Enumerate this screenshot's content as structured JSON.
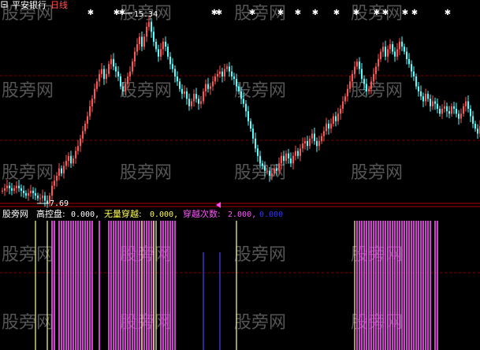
{
  "window": {
    "title_icon": "minus-box-icon",
    "stock_name": "平安银行",
    "period": "日线"
  },
  "colors": {
    "background": "#000000",
    "up": "#ff5555",
    "down": "#54ffff",
    "marker": "#ffffff",
    "divider": "#b00000",
    "grid": "#7a0000",
    "label_default": "#ffffff",
    "label_gaokong": "#ffffff",
    "label_wuliang": "#ffff55",
    "label_chuanyue": "#ff55ff",
    "label_extra": "#3333ff",
    "bar_magenta": "#ff55ff",
    "bar_yellow": "#ffff99",
    "bar_blue": "#4444ff",
    "arrow_magenta": "#ff44ff",
    "watermark": "#555555"
  },
  "watermark": "股旁网",
  "main_panel": {
    "high_label": "15.34",
    "low_label": "7.69"
  },
  "indicator": {
    "name": "股旁网",
    "items": [
      {
        "label": "高控盘:",
        "value": "0.000,"
      },
      {
        "label": "无量穿越:",
        "value": "0.000,"
      },
      {
        "label": "穿越次数:",
        "value": "2.000,"
      },
      {
        "label": "",
        "value": "0.000"
      }
    ]
  },
  "chart_data": [
    {
      "type": "candlestick",
      "title": "平安银行 日线",
      "ylim": [
        7.0,
        16.0
      ],
      "high": 15.34,
      "low": 7.69,
      "grid": "horizontal dashed",
      "close": [
        8.2,
        8.3,
        8.4,
        8.3,
        8.2,
        8.3,
        8.4,
        8.3,
        8.2,
        8.1,
        8.0,
        8.1,
        8.2,
        8.1,
        8.0,
        7.9,
        7.9,
        8.0,
        7.8,
        7.69,
        8.0,
        8.4,
        8.6,
        8.8,
        9.1,
        8.9,
        9.2,
        9.4,
        9.6,
        9.3,
        9.5,
        9.8,
        10.0,
        10.3,
        10.6,
        10.9,
        11.2,
        11.6,
        11.9,
        12.3,
        12.6,
        12.9,
        13.1,
        12.7,
        12.9,
        13.3,
        13.5,
        13.2,
        13.0,
        12.8,
        12.4,
        12.2,
        12.5,
        12.8,
        13.0,
        13.4,
        13.8,
        14.1,
        14.4,
        14.0,
        14.4,
        14.8,
        15.0,
        14.6,
        14.2,
        13.9,
        13.6,
        13.9,
        14.2,
        14.0,
        13.6,
        13.3,
        13.1,
        12.8,
        12.6,
        12.3,
        12.1,
        12.2,
        11.9,
        11.6,
        11.8,
        12.1,
        11.9,
        11.7,
        11.8,
        12.2,
        12.5,
        12.3,
        12.4,
        12.6,
        12.8,
        12.9,
        13.0,
        12.8,
        13.1,
        13.2,
        13.0,
        12.8,
        12.7,
        12.4,
        12.2,
        11.9,
        11.7,
        11.4,
        11.0,
        10.7,
        10.3,
        9.9,
        9.6,
        9.3,
        9.2,
        9.0,
        9.0,
        8.8,
        8.9,
        9.1,
        9.0,
        9.3,
        9.6,
        9.4,
        9.7,
        9.5,
        9.3,
        9.6,
        9.8,
        9.6,
        9.9,
        10.1,
        10.2,
        10.0,
        10.3,
        10.5,
        10.2,
        10.0,
        10.2,
        10.4,
        10.6,
        10.9,
        10.7,
        10.9,
        11.2,
        11.0,
        11.3,
        11.5,
        11.8,
        12.0,
        12.3,
        12.6,
        12.9,
        13.2,
        13.4,
        13.1,
        12.7,
        12.5,
        12.2,
        12.3,
        12.6,
        12.9,
        13.2,
        13.5,
        13.8,
        14.0,
        13.6,
        13.9,
        14.1,
        13.8,
        13.6,
        13.9,
        14.2,
        14.0,
        13.8,
        13.5,
        13.3,
        13.0,
        12.8,
        12.4,
        12.2,
        12.0,
        11.8,
        12.1,
        11.9,
        11.6,
        11.8,
        11.7,
        11.5,
        11.3,
        11.5,
        11.6,
        11.4,
        11.3,
        11.6,
        11.5,
        11.3,
        11.1,
        11.3,
        11.6,
        11.8,
        11.5,
        11.2,
        10.9,
        10.7,
        10.5,
        10.8,
        10.6,
        10.4
      ]
    },
    {
      "type": "bar",
      "title": "股旁网",
      "series": [
        {
          "name": "高控盘",
          "color": "magenta",
          "x": [
            21,
            22,
            24,
            25,
            26,
            27,
            28,
            29,
            30,
            31,
            32,
            33,
            34,
            35,
            36,
            37,
            38,
            41,
            45,
            46,
            47,
            48,
            49,
            50,
            51,
            52,
            53,
            54,
            55,
            56,
            57,
            58,
            59,
            60,
            61,
            62,
            63,
            64,
            67,
            68,
            69,
            70,
            71,
            72,
            73,
            150,
            151,
            152,
            153,
            154,
            155,
            156,
            157,
            158,
            159,
            160,
            161,
            162,
            163,
            164,
            165,
            166,
            167,
            168,
            169,
            170,
            171,
            172,
            173,
            174,
            175,
            176,
            177,
            178,
            179,
            180,
            181,
            183,
            184
          ]
        },
        {
          "name": "无量穿越",
          "color": "yellow",
          "x": [
            14,
            19,
            59,
            64,
            65,
            99,
            149,
            221,
            231,
            232
          ]
        },
        {
          "name": "穿越次数",
          "color": "blue",
          "x": [
            85,
            92
          ]
        }
      ]
    }
  ]
}
